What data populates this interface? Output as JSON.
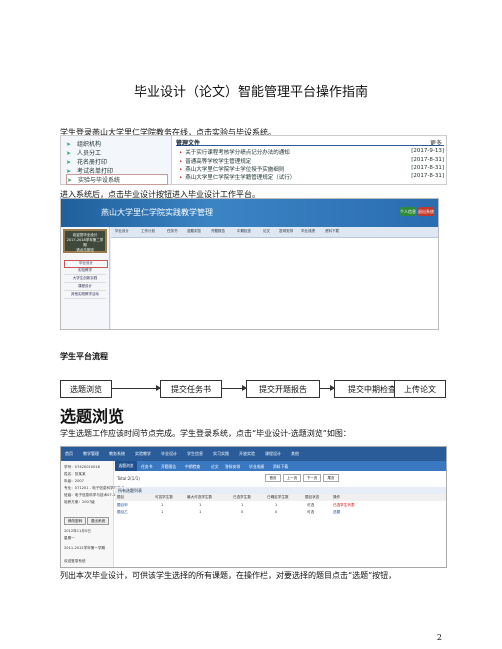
{
  "title": "毕业设计（论文）智能管理平台操作指南",
  "para1": "学生登录燕山大学里仁学院教务在线，点击实验与毕设系统。",
  "s1": {
    "menu": [
      "组织机构",
      "人员分工",
      "花名册打印",
      "考试名单打印",
      "实验与毕设系统"
    ],
    "header_title": "管理文件",
    "header_more": "更多",
    "rows": [
      {
        "text": "关于实行课程考核学分绩点记分办法的通知",
        "date": "[2017-9-13]"
      },
      {
        "text": "普通高等学校学生管理规定",
        "date": "[2017-8-31]"
      },
      {
        "text": "燕山大学里仁学院学士学位授予实施细则",
        "date": "[2017-8-31]"
      },
      {
        "text": "燕山大学里仁学院学生学籍管理规定（试行）",
        "date": "[2017-8-31]"
      }
    ]
  },
  "para2": "进入系统后，点击毕业设计按钮进入毕业设计工作平台。",
  "s2": {
    "banner": "燕山大学里仁学院实践教学管理",
    "board": [
      "欢迎您毕业设计",
      "2017-2018学年第二学期",
      "请点击按钮"
    ],
    "side_items": [
      "毕业设计",
      "实验教学",
      "大学生创新实践",
      "课程设计",
      "其他实践教学活动"
    ],
    "nav": [
      "毕业设计",
      "工作计划",
      "任务书",
      "选题浏览",
      "开题报告",
      "中期检查",
      "论文",
      "答辩安排",
      "毕业成绩",
      "资料下载"
    ],
    "btns": [
      "个人信息",
      "退出系统"
    ]
  },
  "h_flow": "学生平台流程",
  "flow": [
    "选题浏览",
    "提交任务书",
    "提交开题报告",
    "提交中期检查",
    "上传论文"
  ],
  "h1": "选题浏览",
  "para3": "学生选题工作应该时间节点完成。学生登录系统，点击“毕业设计-选题浏览”如图：",
  "s3": {
    "topnav": [
      "首页",
      "教学管理",
      "教务系统",
      "实验教学",
      "毕业设计",
      "学生信息",
      "实习实践",
      "开放实验",
      "课程设计",
      "其他"
    ],
    "left_lines": [
      "学号：07420010016",
      "姓名：张某某",
      "年级：2007",
      "专业：071201 - 电子信息科学与技术",
      "班级：电子信息科学与技术07-1",
      "培养方案：2007级"
    ],
    "left_btns": [
      "修改密码",
      "退出系统"
    ],
    "left_date": "2012年11月5日",
    "left_week": "星期一",
    "left_term": "2011-2012学年第一学期",
    "left_foot": "欢迎登录系统",
    "tabs": [
      "选题浏览",
      "任务书",
      "开题报告",
      "中期检查",
      "论文",
      "答辩安排",
      "毕业成绩",
      "资料下载"
    ],
    "total": "Total:2(1/1)",
    "pager": [
      "首页",
      "上一页",
      "下一页",
      "尾页"
    ],
    "list_title": "所有选题列表",
    "cols": [
      "题目",
      "可容学生数",
      "最大可选学生数",
      "已选学生数",
      "已确定学生数",
      "题目状态",
      "操作"
    ],
    "rows": [
      [
        "题目甲",
        "1",
        "1",
        "1",
        "1",
        "可选",
        "已选学生列表"
      ],
      [
        "题目乙",
        "1",
        "1",
        "0",
        "0",
        "可选",
        "选题"
      ]
    ]
  },
  "para4": "列出本次毕业设计，可供该学生选择的所有课题，在操作栏，对要选择的题目点击“选题”按钮，",
  "page_number": "2"
}
